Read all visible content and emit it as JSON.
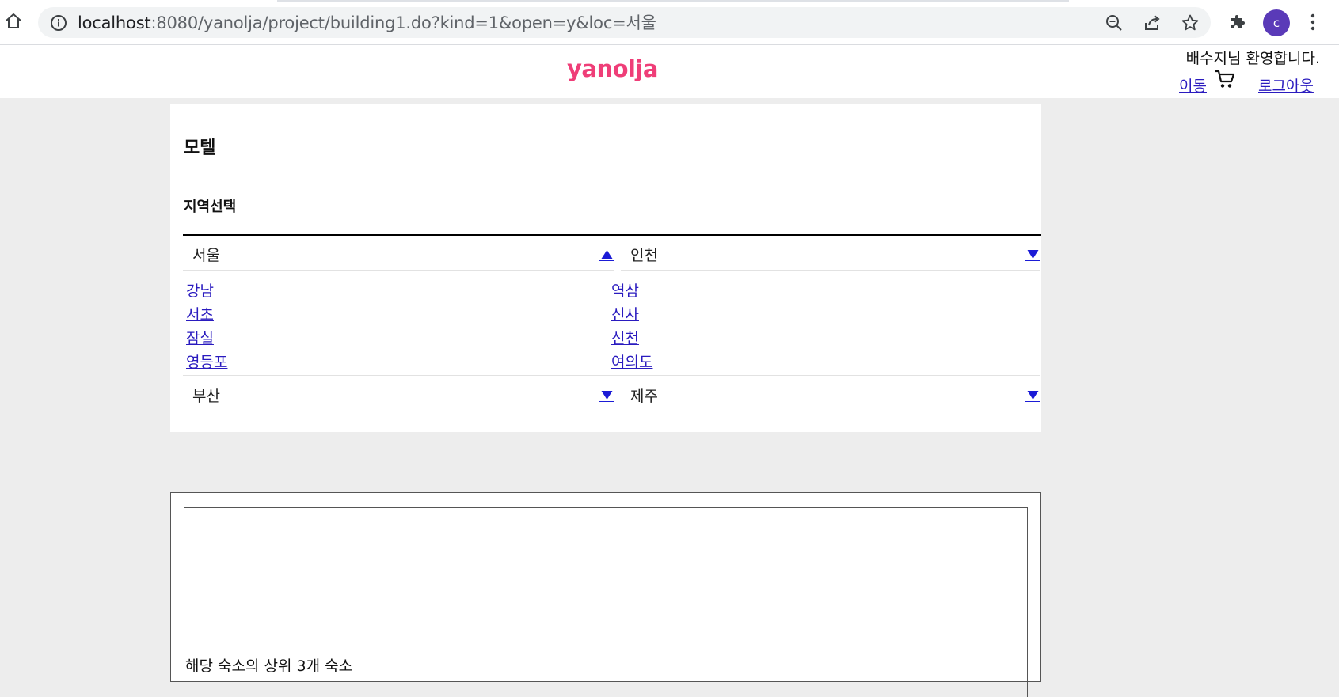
{
  "browser": {
    "url_host": "localhost",
    "url_rest": ":8080/yanolja/project/building1.do?kind=1&open=y&loc=서울",
    "avatar_letter": "c"
  },
  "header": {
    "logo": "yanolja",
    "welcome": "배수지님 환영합니다.",
    "move_link": "이동",
    "logout_link": "로그아웃",
    "logo_color": "#ef3e78"
  },
  "panel": {
    "title": "모텔",
    "section_title": "지역선택",
    "regions": [
      {
        "name": "서울",
        "expanded": true,
        "subregions": [
          "강남",
          "서초",
          "잠실",
          "영등포"
        ]
      },
      {
        "name": "인천",
        "expanded": false,
        "subregions": [
          "역삼",
          "신사",
          "신천",
          "여의도"
        ]
      },
      {
        "name": "부산",
        "expanded": false
      },
      {
        "name": "제주",
        "expanded": false
      }
    ]
  },
  "results": {
    "caption": "해당 숙소의 상위 3개 숙소"
  }
}
